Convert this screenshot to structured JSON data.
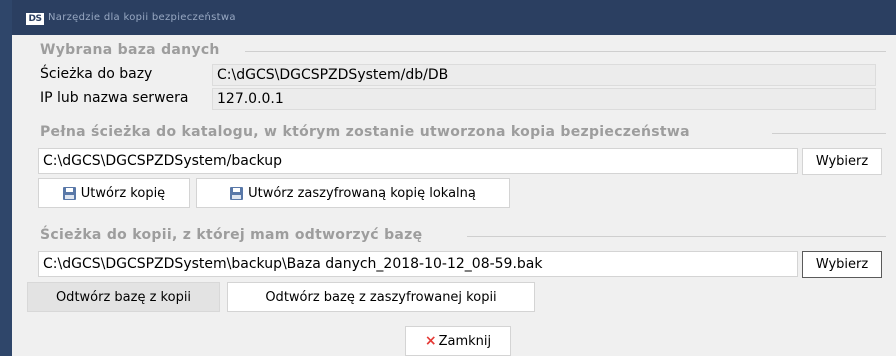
{
  "window": {
    "logo": "DS",
    "title": "Narzędzie dla kopii bezpieczeństwa"
  },
  "database": {
    "section_title": "Wybrana baza danych",
    "path_label": "Ścieżka do bazy",
    "path_value": "C:\\dGCS\\DGCSPZDSystem/db/DB",
    "server_label": "IP lub nazwa serwera",
    "server_value": "127.0.0.1"
  },
  "backup": {
    "section_title": "Pełna ścieżka do katalogu, w którym zostanie utworzona kopia bezpieczeństwa",
    "path_value": "C:\\dGCS\\DGCSPZDSystem/backup",
    "choose_label": "Wybierz",
    "create_label": "Utwórz kopię",
    "create_encrypted_label": "Utwórz zaszyfrowaną kopię lokalną"
  },
  "restore": {
    "section_title": "Ścieżka do kopii, z której mam odtworzyć bazę",
    "path_value": "C:\\dGCS\\DGCSPZDSystem\\backup\\Baza danych_2018-10-12_08-59.bak",
    "choose_label": "Wybierz",
    "restore_label": "Odtwórz bazę z kopii",
    "restore_encrypted_label": "Odtwórz bazę z zaszyfrowanej kopii"
  },
  "footer": {
    "close_label": "Zamknij",
    "close_glyph": "×"
  },
  "colors": {
    "titlebar": "#2b3f61",
    "content_bg": "#f0f0f0",
    "section_title": "#9d9d9d",
    "close_icon": "#e53935",
    "floppy_icon": "#5978a8"
  }
}
